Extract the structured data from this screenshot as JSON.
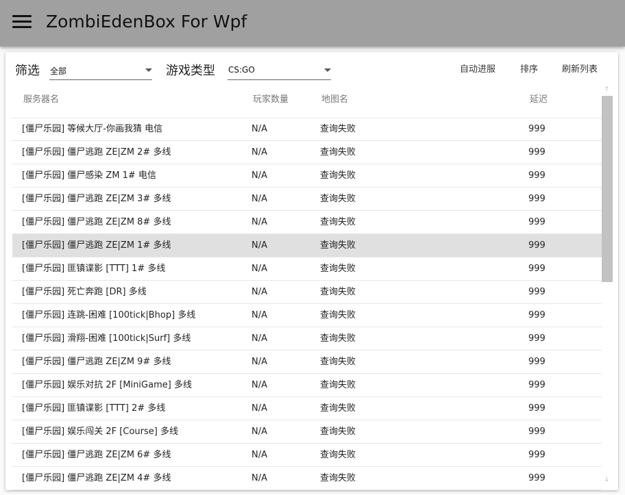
{
  "appbar": {
    "menu_icon": "hamburger-menu-icon",
    "title": "ZombiEdenBox For Wpf"
  },
  "filters": {
    "filter_label": "筛选",
    "filter_value": "全部",
    "game_type_label": "游戏类型",
    "game_type_value": "CS:GO"
  },
  "toolbar": {
    "auto_join": "自动进服",
    "sort": "排序",
    "refresh": "刷新列表"
  },
  "table": {
    "columns": [
      "服务器名",
      "玩家数量",
      "地图名",
      "延迟"
    ],
    "selected_index": 5,
    "rows": [
      [
        "[僵尸乐园] 等候大厅-你画我猜 电信",
        "N/A",
        "查询失败",
        "999"
      ],
      [
        "[僵尸乐园] 僵尸逃跑 ZE|ZM 2# 多线",
        "N/A",
        "查询失败",
        "999"
      ],
      [
        "[僵尸乐园] 僵尸感染 ZM 1# 电信",
        "N/A",
        "查询失败",
        "999"
      ],
      [
        "[僵尸乐园] 僵尸逃跑 ZE|ZM 3# 多线",
        "N/A",
        "查询失败",
        "999"
      ],
      [
        "[僵尸乐园] 僵尸逃跑 ZE|ZM 8# 多线",
        "N/A",
        "查询失败",
        "999"
      ],
      [
        "[僵尸乐园] 僵尸逃跑 ZE|ZM 1# 多线",
        "N/A",
        "查询失败",
        "999"
      ],
      [
        "[僵尸乐园] 匪镇谍影 [TTT] 1# 多线",
        "N/A",
        "查询失败",
        "999"
      ],
      [
        "[僵尸乐园] 死亡奔跑 [DR] 多线",
        "N/A",
        "查询失败",
        "999"
      ],
      [
        "[僵尸乐园] 连跳-困难 [100tick|Bhop] 多线",
        "N/A",
        "查询失败",
        "999"
      ],
      [
        "[僵尸乐园] 滑翔-困难 [100tick|Surf] 多线",
        "N/A",
        "查询失败",
        "999"
      ],
      [
        "[僵尸乐园] 僵尸逃跑 ZE|ZM 9# 多线",
        "N/A",
        "查询失败",
        "999"
      ],
      [
        "[僵尸乐园] 娱乐对抗 2F [MiniGame] 多线",
        "N/A",
        "查询失败",
        "999"
      ],
      [
        "[僵尸乐园] 匪镇谍影 [TTT] 2# 多线",
        "N/A",
        "查询失败",
        "999"
      ],
      [
        "[僵尸乐园] 娱乐闯关 2F [Course] 多线",
        "N/A",
        "查询失败",
        "999"
      ],
      [
        "[僵尸乐园] 僵尸逃跑 ZE|ZM 6# 多线",
        "N/A",
        "查询失败",
        "999"
      ],
      [
        "[僵尸乐园] 僵尸逃跑 ZE|ZM 4# 多线",
        "N/A",
        "查询失败",
        "999"
      ]
    ]
  },
  "scrollbar": {
    "up_glyph": "↑",
    "down_glyph": "↓"
  },
  "colors": {
    "appbar": "#a0a0a0",
    "selected_row": "#e0e0e0",
    "scroll_thumb": "#c2c2c2"
  }
}
